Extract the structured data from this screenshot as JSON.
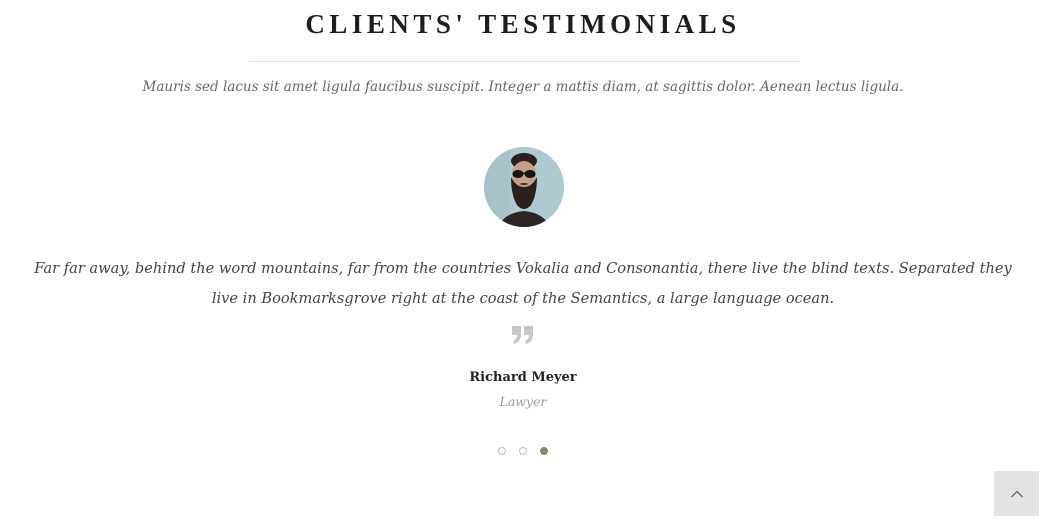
{
  "section": {
    "title": "CLIENTS' TESTIMONIALS",
    "subtitle": "Mauris sed lacus sit amet ligula faucibus suscipit. Integer a mattis diam, at sagittis dolor. Aenean lectus ligula."
  },
  "testimonial": {
    "avatar_icon": "bearded-man-avatar",
    "quote": "Far far away, behind the word mountains, far from the countries Vokalia and Consonantia, there live the blind texts. Separated they live in Bookmarksgrove right at the coast of the Semantics, a large language ocean.",
    "quote_icon": "quote-icon",
    "author_name": "Richard Meyer",
    "author_role": "Lawyer"
  },
  "pagination": {
    "total": 3,
    "active_index": 2
  },
  "back_to_top": {
    "icon": "chevron-up-icon"
  },
  "colors": {
    "accent": "#8a8a6a",
    "title": "#1d1d1d",
    "muted": "#999999",
    "button_bg": "#e3e3e3"
  }
}
